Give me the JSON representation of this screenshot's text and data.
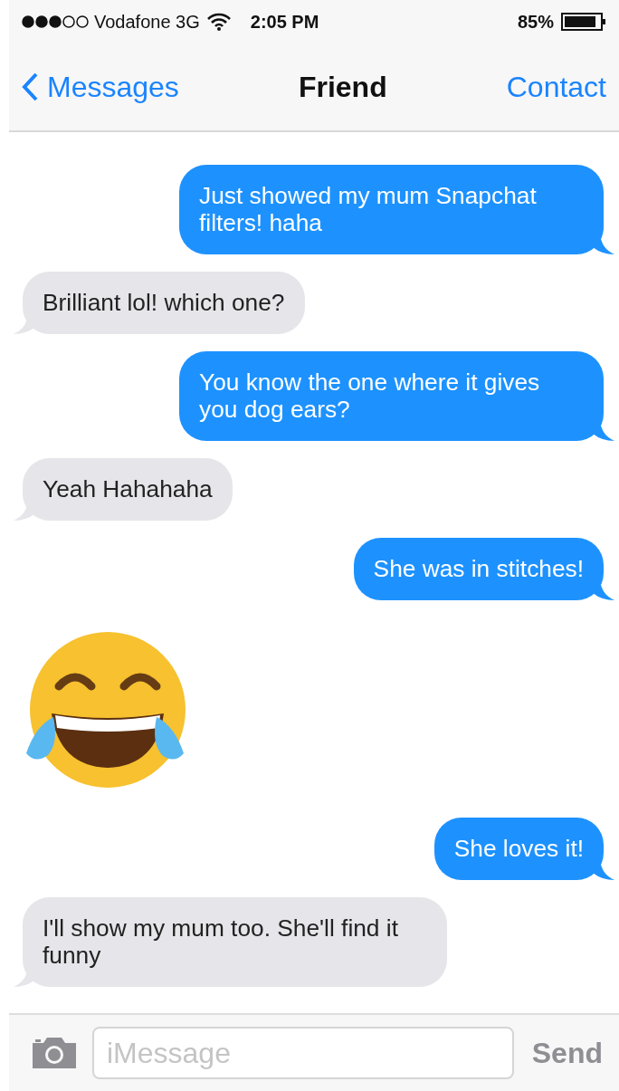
{
  "status_bar": {
    "carrier": "Vodafone 3G",
    "time": "2:05 PM",
    "battery": "85%"
  },
  "nav": {
    "back": "Messages",
    "title": "Friend",
    "action": "Contact"
  },
  "messages": [
    {
      "kind": "text",
      "sent": true,
      "text": "Just showed my mum Snapchat filters! haha"
    },
    {
      "kind": "text",
      "sent": false,
      "text": "Brilliant lol! which one?"
    },
    {
      "kind": "text",
      "sent": true,
      "text": "You know the one where it gives you dog ears?"
    },
    {
      "kind": "text",
      "sent": false,
      "text": "Yeah Hahahaha"
    },
    {
      "kind": "text",
      "sent": true,
      "text": "She was in stitches!"
    },
    {
      "kind": "emoji",
      "sent": false
    },
    {
      "kind": "text",
      "sent": true,
      "text": "She loves it!"
    },
    {
      "kind": "text",
      "sent": false,
      "text": "I'll show my mum too. She'll find it funny"
    }
  ],
  "composer": {
    "placeholder": "iMessage",
    "send": "Send"
  }
}
